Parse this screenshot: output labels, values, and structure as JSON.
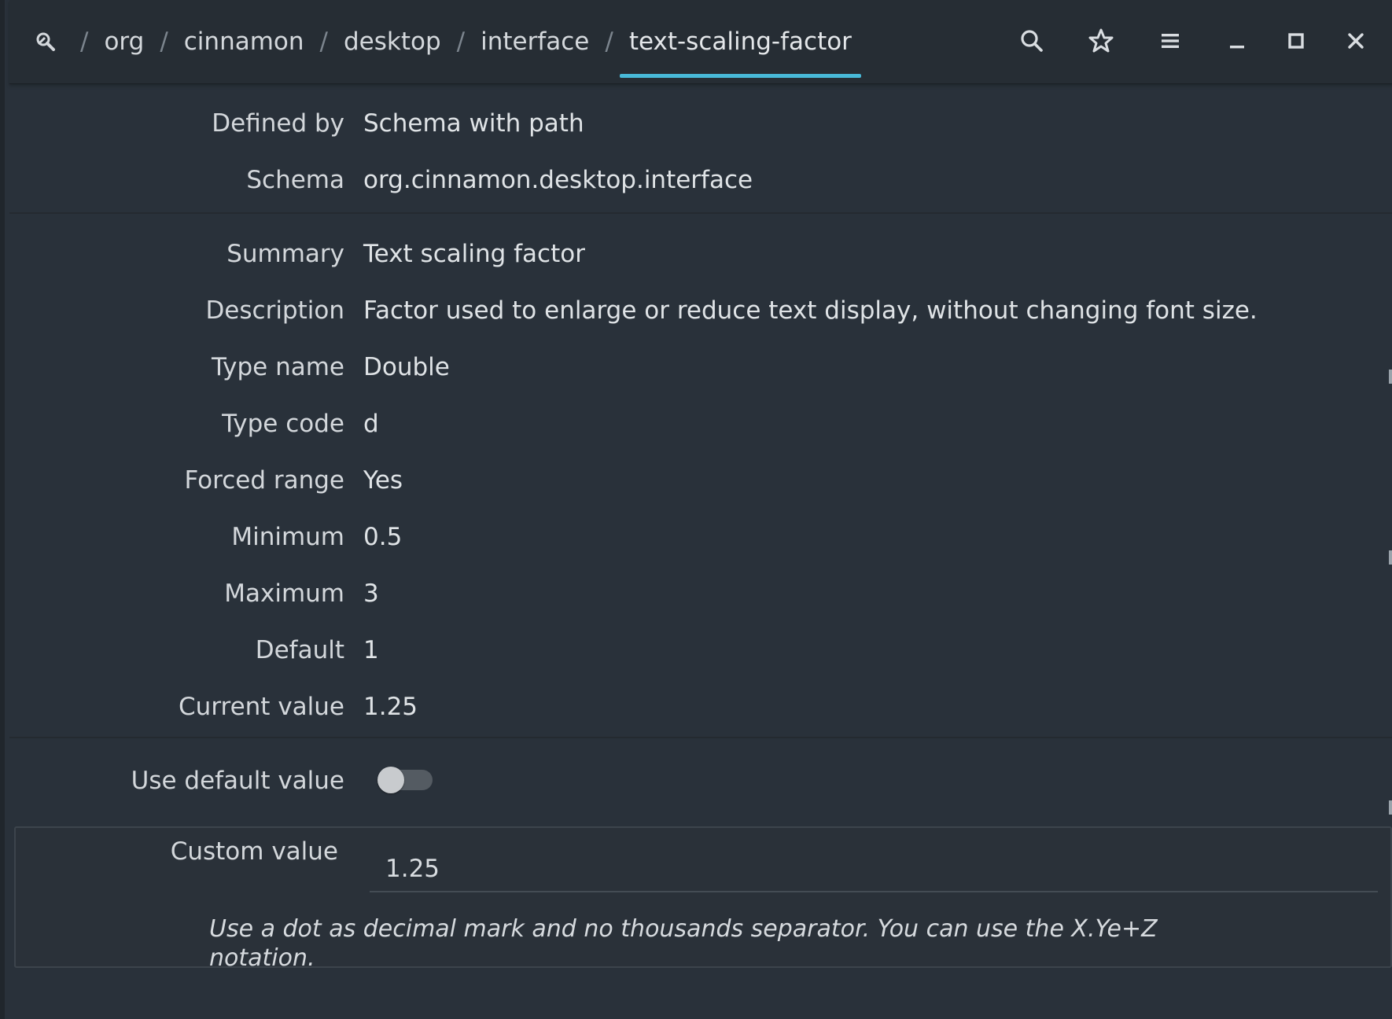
{
  "breadcrumb": {
    "root_icon": "search-edit-icon",
    "items": [
      "org",
      "cinnamon",
      "desktop",
      "interface",
      "text-scaling-factor"
    ],
    "separator": "/"
  },
  "headerbar": {
    "icons": [
      "search-icon",
      "star-icon",
      "hamburger-menu-icon",
      "minimize-icon",
      "maximize-icon",
      "close-icon"
    ]
  },
  "details": {
    "defined_by": {
      "label": "Defined by",
      "value": "Schema with path"
    },
    "schema": {
      "label": "Schema",
      "value": "org.cinnamon.desktop.interface"
    },
    "summary": {
      "label": "Summary",
      "value": "Text scaling factor"
    },
    "description": {
      "label": "Description",
      "value": "Factor used to enlarge or reduce text display, without changing font size."
    },
    "type_name": {
      "label": "Type name",
      "value": "Double"
    },
    "type_code": {
      "label": "Type code",
      "value": "d"
    },
    "forced_range": {
      "label": "Forced range",
      "value": "Yes"
    },
    "minimum": {
      "label": "Minimum",
      "value": "0.5"
    },
    "maximum": {
      "label": "Maximum",
      "value": "3"
    },
    "default": {
      "label": "Default",
      "value": "1"
    },
    "current_value": {
      "label": "Current value",
      "value": "1.25"
    }
  },
  "use_default": {
    "label": "Use default value",
    "enabled": false
  },
  "custom": {
    "label": "Custom value",
    "value": "1.25",
    "hint": "Use a dot as decimal mark and no thousands separator. You can use the X.Ye+Z notation."
  },
  "colors": {
    "accent": "#48b9d8",
    "background": "#29313a",
    "headerbar": "#262d34"
  }
}
